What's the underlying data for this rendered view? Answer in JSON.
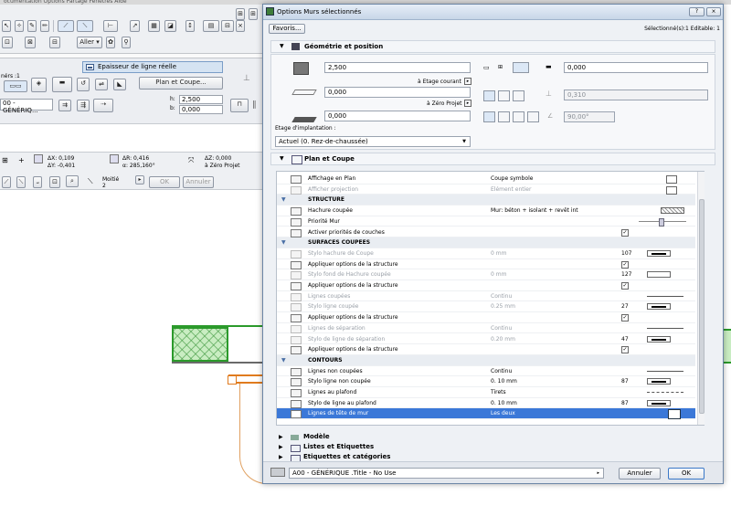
{
  "menubar": {
    "text": "ocumentation    Options    Partage    Fenêtres    Aide"
  },
  "toolbar": {
    "aller_label": "Aller ▾"
  },
  "info_panel": {
    "layer_label": "nérs :1",
    "plan_coupe_button": "Plan et Coupe...",
    "height_label": "h:",
    "height_value": "2,500",
    "b_label": "b:",
    "b_value": "0,000",
    "layer_select": "00 - GÉNÉRIQ..."
  },
  "tooltip": {
    "text": "Epaisseur de ligne réelle"
  },
  "coords": {
    "dx_value": "ΔX: 0,109",
    "dy_value": "ΔY: -0,401",
    "dr_value": "ΔR: 0,416",
    "angle_value": "α: 285,160°",
    "dz_value": "ΔZ: 0,000",
    "zero_label": "à Zéro Projet",
    "moitie_label": "Moitié",
    "moitie_num": "2",
    "ok_label": "OK",
    "cancel_label": "Annuler"
  },
  "dialog": {
    "title": "Options Murs sélectionnés",
    "help_btn": "?",
    "close_btn": "⨯",
    "favoris_btn": "Favoris...",
    "selection_info": "Sélectionné(s):1 Editable: 1"
  },
  "geometry": {
    "header": "Géométrie et position",
    "height_value": "2,500",
    "etage_courant_label": "à Etage courant",
    "base_value": "0,000",
    "zero_projet_label": "à Zéro Projet",
    "bottom_value": "0,000",
    "etage_impl_label": "Etage d'implantation :",
    "etage_impl_value": "Actuel (0. Rez-de-chaussée)",
    "thickness_value": "0,000",
    "offset_value": "0,310",
    "angle_value": "90,00°"
  },
  "plan_coupe": {
    "header": "Plan et Coupe",
    "rows": [
      {
        "type": "item",
        "name": "Affichage en Plan",
        "value": "Coupe symbole",
        "num": "",
        "extra": "icon"
      },
      {
        "type": "item",
        "name": "Afficher projection",
        "value": "Elément entier",
        "num": "",
        "extra": "icon",
        "disabled": true
      },
      {
        "type": "group",
        "name": "STRUCTURE"
      },
      {
        "type": "item",
        "name": "Hachure coupée",
        "value": "Mur: béton + isolant + revêt int",
        "num": "",
        "extra": "hatch"
      },
      {
        "type": "item",
        "name": "Priorité Mur",
        "value": "",
        "num": "",
        "extra": "slider"
      },
      {
        "type": "item",
        "name": "Activer priorités de couches",
        "value": "",
        "num": "",
        "extra": "check"
      },
      {
        "type": "group",
        "name": "SURFACES COUPEES"
      },
      {
        "type": "item",
        "name": "Stylo hachure de Coupe",
        "value": "0 mm",
        "num": "107",
        "extra": "line",
        "disabled": true
      },
      {
        "type": "item",
        "name": "Appliquer options de la structure",
        "value": "",
        "num": "",
        "extra": "check"
      },
      {
        "type": "item",
        "name": "Stylo fond de Hachure coupée",
        "value": "0 mm",
        "num": "127",
        "extra": "emptybox",
        "disabled": true
      },
      {
        "type": "item",
        "name": "Appliquer options de la structure",
        "value": "",
        "num": "",
        "extra": "check"
      },
      {
        "type": "item",
        "name": "Lignes coupées",
        "value": "Continu",
        "num": "",
        "extra": "hline",
        "disabled": true
      },
      {
        "type": "item",
        "name": "Stylo ligne coupée",
        "value": "0.25 mm",
        "num": "27",
        "extra": "line",
        "disabled": true
      },
      {
        "type": "item",
        "name": "Appliquer options de la structure",
        "value": "",
        "num": "",
        "extra": "check"
      },
      {
        "type": "item",
        "name": "Lignes de séparation",
        "value": "Continu",
        "num": "",
        "extra": "hline",
        "disabled": true
      },
      {
        "type": "item",
        "name": "Stylo de ligne de séparation",
        "value": "0.20 mm",
        "num": "47",
        "extra": "line",
        "disabled": true
      },
      {
        "type": "item",
        "name": "Appliquer options de la structure",
        "value": "",
        "num": "",
        "extra": "check"
      },
      {
        "type": "group",
        "name": "CONTOURS"
      },
      {
        "type": "item",
        "name": "Lignes non coupées",
        "value": "Continu",
        "num": "",
        "extra": "hline"
      },
      {
        "type": "item",
        "name": "Stylo ligne non coupée",
        "value": "0. 10 mm",
        "num": "87",
        "extra": "line"
      },
      {
        "type": "item",
        "name": "Lignes au plafond",
        "value": "Tirets",
        "num": "",
        "extra": "dline"
      },
      {
        "type": "item",
        "name": "Stylo de ligne au plafond",
        "value": "0. 10 mm",
        "num": "87",
        "extra": "line"
      },
      {
        "type": "item",
        "name": "Lignes de tête de mur",
        "value": "Les deux",
        "num": "",
        "extra": "selbtn",
        "selected": true
      }
    ]
  },
  "collapsed_sections": [
    "Modèle",
    "Listes et Etiquettes",
    "Etiquettes et catégories"
  ],
  "footer": {
    "layer_value": "A00 - GÉNÉRIQUE .Title - No Use",
    "cancel_button": "Annuler",
    "ok_button": "OK"
  }
}
